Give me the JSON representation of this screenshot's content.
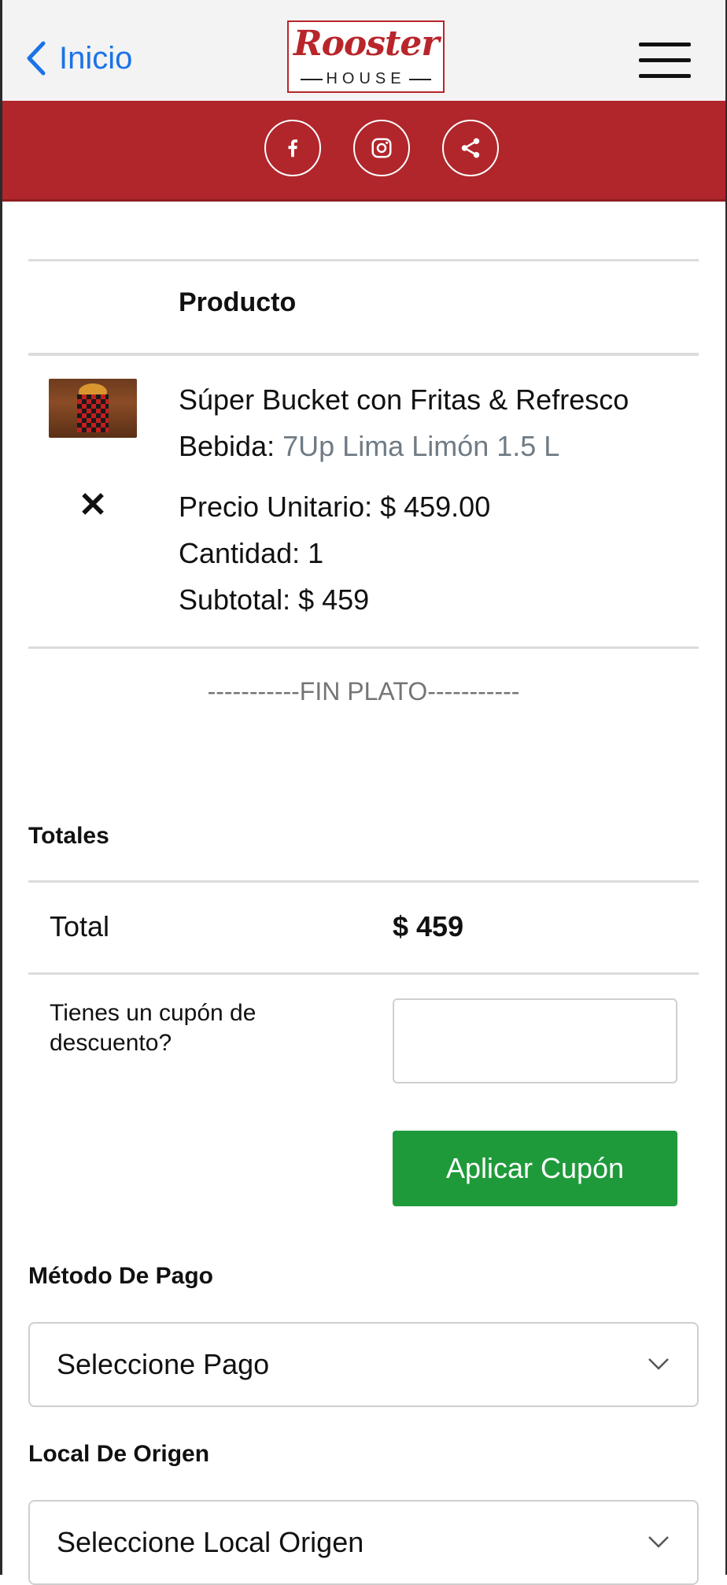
{
  "header": {
    "back_label": "Inicio",
    "logo_text": "Rooster",
    "logo_sub": "HOUSE",
    "brand_color": "#b0262b"
  },
  "social": {
    "icons": [
      "facebook-icon",
      "instagram-icon",
      "share-icon"
    ]
  },
  "cart": {
    "column_header": "Producto",
    "item": {
      "name": "Súper Bucket con Fritas & Refresco",
      "drink_label": "Bebida:",
      "drink_value": "7Up Lima Limón 1.5 L",
      "unit_price": "Precio Unitario: $ 459.00",
      "quantity": "Cantidad: 1",
      "subtotal": "Subtotal: $ 459",
      "remove_symbol": "✕"
    },
    "separator": "-----------FIN PLATO-----------"
  },
  "totals": {
    "heading": "Totales",
    "total_label": "Total",
    "total_value": "$ 459",
    "coupon_question": "Tienes un cupón de descuento?",
    "coupon_value": "",
    "apply_label": "Aplicar Cupón",
    "apply_color": "#1f9a3b"
  },
  "payment": {
    "heading": "Método De Pago",
    "selected": "Seleccione Pago"
  },
  "origin": {
    "heading": "Local De Origen",
    "selected": "Seleccione Local Origen"
  }
}
